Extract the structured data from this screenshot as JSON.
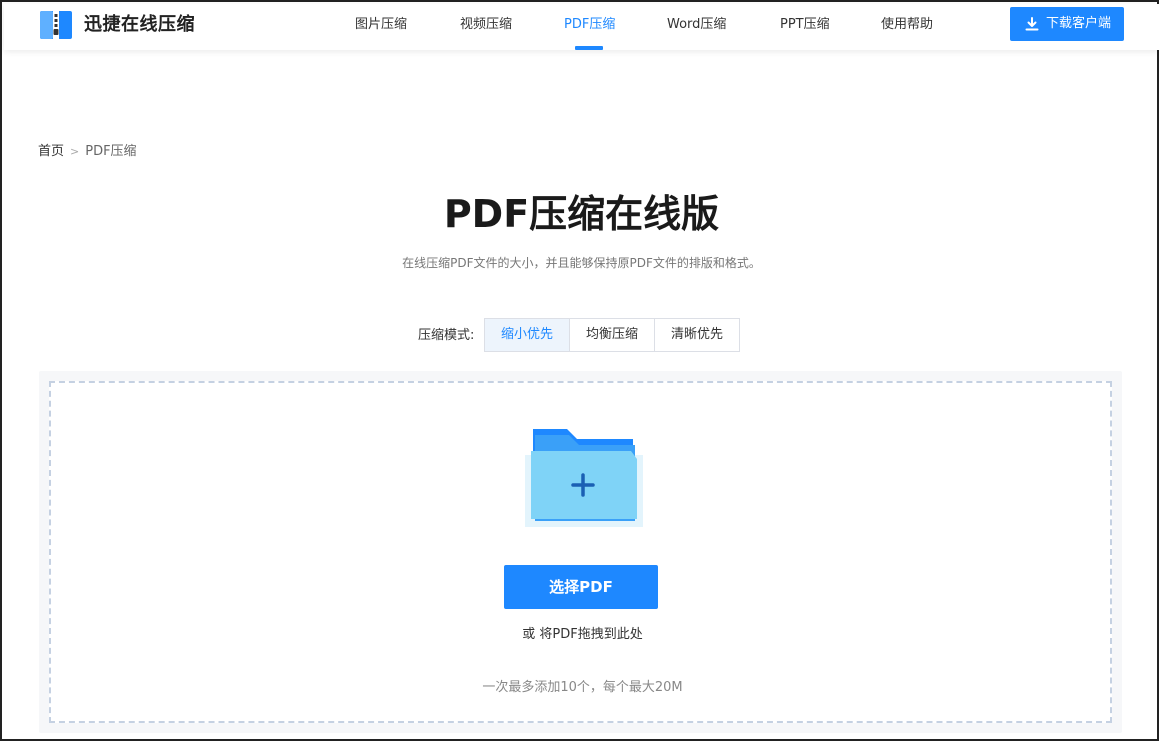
{
  "header": {
    "brand": "迅捷在线压缩",
    "nav": [
      {
        "label": "图片压缩"
      },
      {
        "label": "视频压缩"
      },
      {
        "label": "PDF压缩"
      },
      {
        "label": "Word压缩"
      },
      {
        "label": "PPT压缩"
      },
      {
        "label": "使用帮助"
      }
    ],
    "active_nav": "PDF压缩",
    "download_label": "下载客户端"
  },
  "breadcrumb": {
    "home": "首页",
    "current": "PDF压缩"
  },
  "title": "PDF压缩在线版",
  "subtitle": "在线压缩PDF文件的大小，并且能够保持原PDF文件的排版和格式。",
  "mode": {
    "label": "压缩模式:",
    "options": [
      {
        "label": "缩小优先"
      },
      {
        "label": "均衡压缩"
      },
      {
        "label": "清晰优先"
      }
    ],
    "selected": "缩小优先"
  },
  "upload": {
    "button_label": "选择PDF",
    "drag_hint": "或 将PDF拖拽到此处",
    "limit_hint": "一次最多添加10个，每个最大20M"
  },
  "colors": {
    "accent": "#1e88ff",
    "folder_dark": "#1e88ff",
    "folder_light": "#7fd3f7"
  },
  "icons": {
    "logo": "zip-file-icon",
    "download": "download-icon",
    "upload": "folder-plus-icon"
  }
}
